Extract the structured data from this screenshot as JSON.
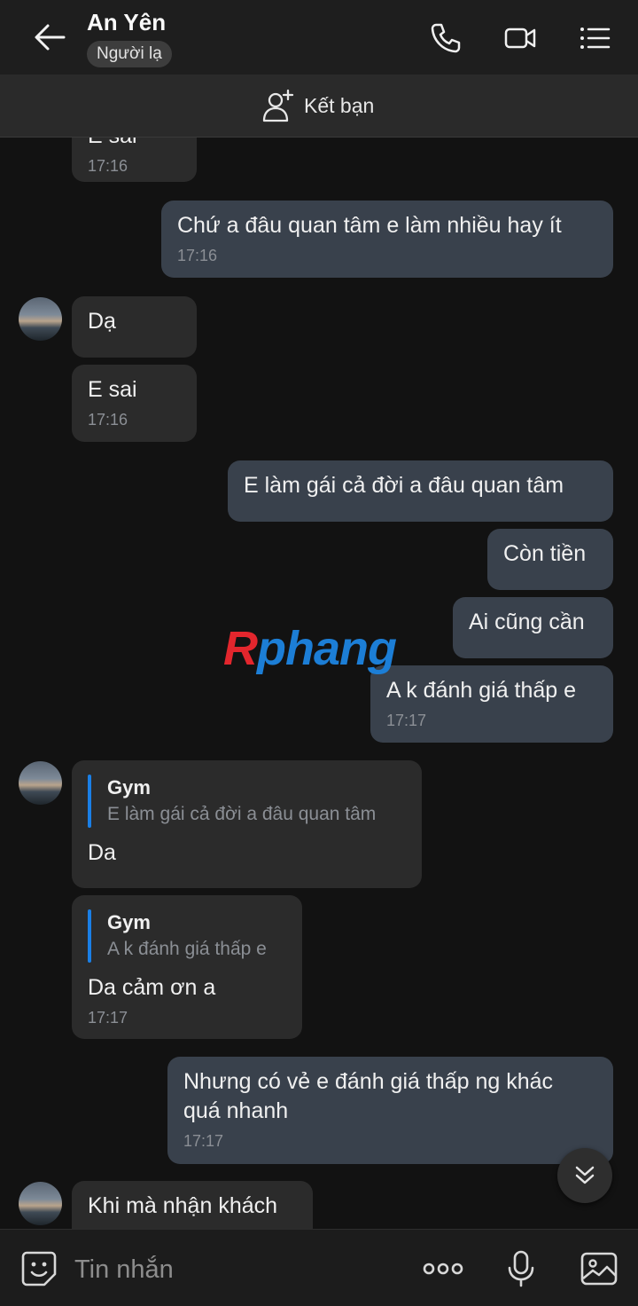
{
  "header": {
    "title": "An Yên",
    "badge": "Người lạ",
    "add_friend": "Kết bạn"
  },
  "messages": [
    {
      "dir": "in",
      "text": "E sai",
      "time": "17:16"
    },
    {
      "dir": "out",
      "text": "Chứ a đâu quan tâm e làm nhiều hay ít",
      "time": "17:16"
    },
    {
      "dir": "in",
      "text": "Dạ"
    },
    {
      "dir": "in",
      "text": "E sai",
      "time": "17:16"
    },
    {
      "dir": "out",
      "text": "E làm gái cả đời a đâu quan tâm"
    },
    {
      "dir": "out",
      "text": "Còn tiền"
    },
    {
      "dir": "out",
      "text": "Ai cũng cần"
    },
    {
      "dir": "out",
      "text": "A k đánh giá thấp e",
      "time": "17:17"
    },
    {
      "dir": "in",
      "quote_name": "Gym",
      "quote_text": "E làm gái cả đời a đâu quan tâm",
      "text": "Da"
    },
    {
      "dir": "in",
      "quote_name": "Gym",
      "quote_text": "A k đánh giá thấp e",
      "text": "Da cảm ơn a",
      "time": "17:17"
    },
    {
      "dir": "out",
      "text_line1": "Nhưng có vẻ e đánh giá thấp ng khác",
      "text_line2": "quá nhanh",
      "time": "17:17"
    },
    {
      "dir": "in",
      "text": "Khi mà nhận khách"
    }
  ],
  "watermark": {
    "part1": "R",
    "part2": "phang",
    "color1": "#e3262d",
    "color2": "#1c7ed6"
  },
  "composer": {
    "placeholder": "Tin nhắn"
  },
  "icons": {
    "back": "arrow-left-icon",
    "call": "phone-icon",
    "video": "video-camera-icon",
    "menu": "list-menu-icon",
    "add_friend": "add-user-icon",
    "emoji": "emoji-sticker-icon",
    "more": "more-dots-icon",
    "mic": "microphone-icon",
    "image": "image-icon",
    "scroll": "double-chevron-down-icon"
  }
}
